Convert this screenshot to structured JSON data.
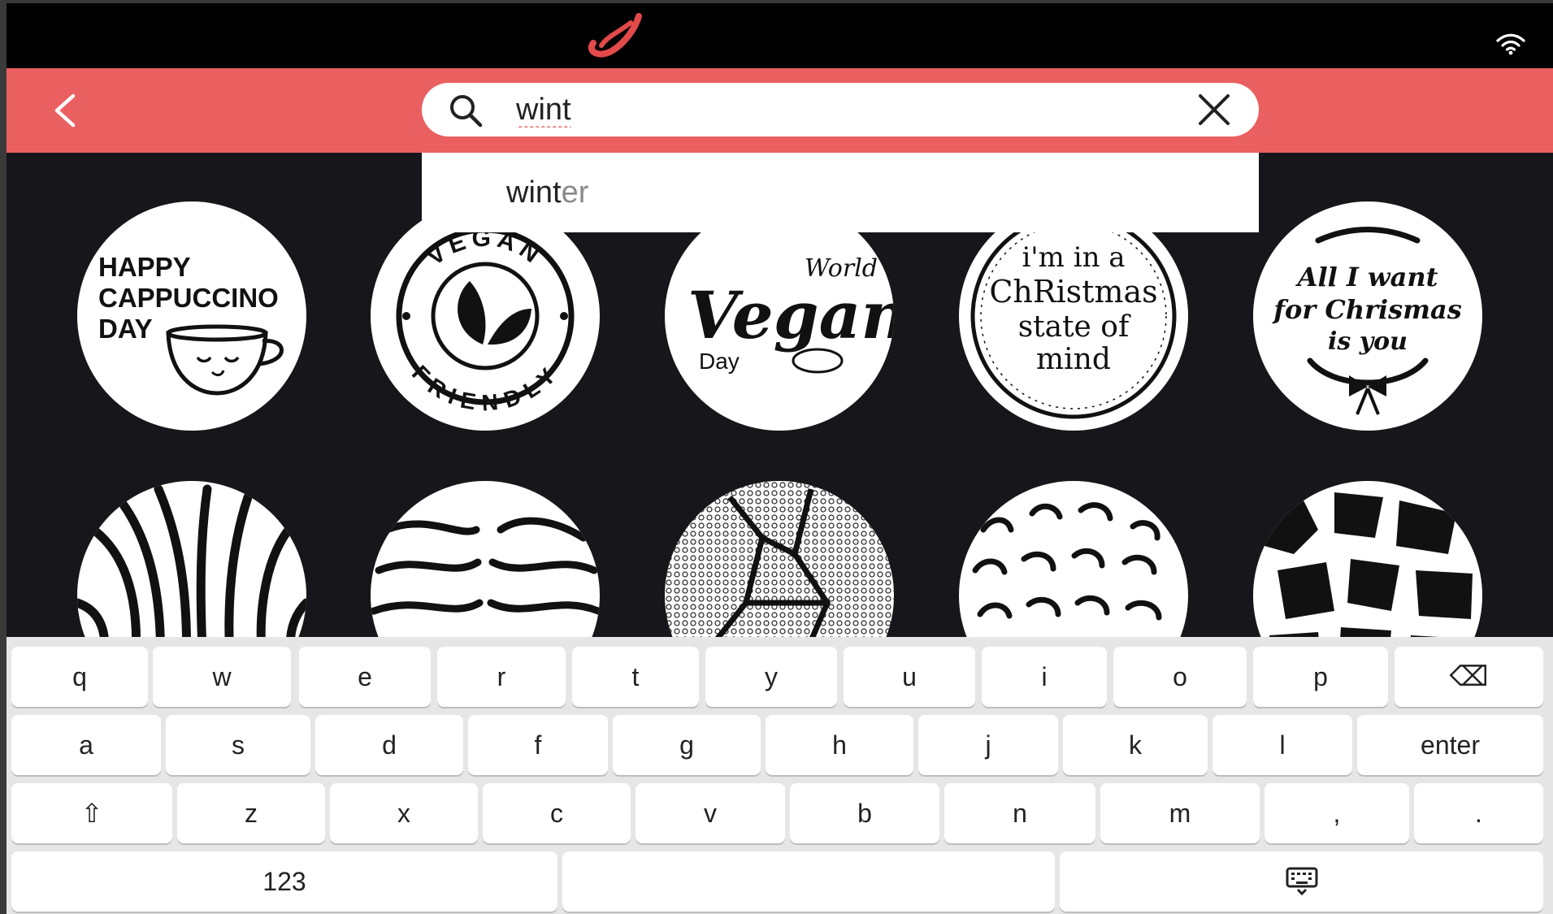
{
  "header": {
    "search": {
      "value": "wint",
      "placeholder": ""
    }
  },
  "suggestions": [
    {
      "typed": "wint",
      "completion": "er"
    }
  ],
  "stickers": [
    {
      "name": "sticker-happy-cappuccino-day",
      "lines": [
        "HAPPY",
        "CAPPUCCINO",
        "DAY"
      ]
    },
    {
      "name": "sticker-vegan-friendly",
      "top_text": "VEGAN",
      "bottom_text": "FRIENDLY"
    },
    {
      "name": "sticker-world-vegan-day",
      "world": "World",
      "vegan": "Vegan",
      "day": "Day"
    },
    {
      "name": "sticker-christmas-state-of-mind",
      "lines": [
        "i'm in a",
        "ChRistmas",
        "state of",
        "mind"
      ]
    },
    {
      "name": "sticker-all-i-want-for-christmas",
      "lines": [
        "All I want",
        "for Chrismas",
        "is you"
      ]
    },
    {
      "name": "sticker-zebra-pattern"
    },
    {
      "name": "sticker-tiger-pattern"
    },
    {
      "name": "sticker-snake-pattern"
    },
    {
      "name": "sticker-leopard-pattern"
    },
    {
      "name": "sticker-giraffe-pattern"
    }
  ],
  "keyboard": {
    "row1": [
      "q",
      "w",
      "e",
      "r",
      "t",
      "y",
      "u",
      "i",
      "o",
      "p",
      "⌫"
    ],
    "row2": [
      "a",
      "s",
      "d",
      "f",
      "g",
      "h",
      "j",
      "k",
      "l",
      "enter"
    ],
    "row3": [
      "⇧",
      "z",
      "x",
      "c",
      "v",
      "b",
      "n",
      "m",
      ",",
      "."
    ],
    "row4": [
      "123",
      "",
      ""
    ]
  },
  "colors": {
    "header": "#ea6060",
    "background": "#17161b",
    "status_bar": "#000000",
    "keyboard": "#e6e6e6"
  },
  "icons": {
    "back": "chevron-left-icon",
    "search": "search-icon",
    "clear": "close-icon",
    "wifi": "wifi-icon",
    "hide_keyboard": "keyboard-hide-icon"
  }
}
